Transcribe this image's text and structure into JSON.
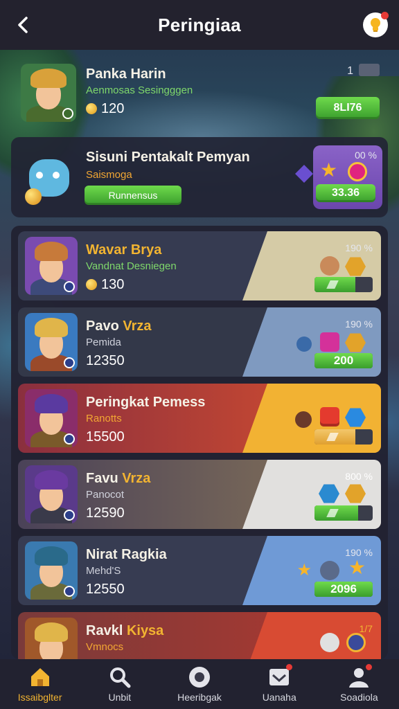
{
  "header": {
    "title": "Peringiaa"
  },
  "featured": {
    "name": "Panka Harin",
    "subtitle": "Aenmosas Sesingggen",
    "score": "120",
    "rank": "1",
    "button": "8LI76"
  },
  "second": {
    "name": "Sisuni Pentakalt Pemyan",
    "subtitle": "Saismoga",
    "button": "Runnensus",
    "rank": "00 %",
    "points": "33.36"
  },
  "rows": [
    {
      "name": "Wavar",
      "name_hl": "Brya",
      "subtitle": "Vandnat Desniegen",
      "score": "130",
      "rank": "190 %",
      "progress": 0.7,
      "prog_label": "",
      "bg": "#363b51",
      "panel": "#d5cba6"
    },
    {
      "name": "Pavo",
      "name_hl": "Vrza",
      "subtitle": "Pemida",
      "score": "12350",
      "rank": "190 %",
      "progress": 1,
      "prog_label": "200",
      "bg": "#333849",
      "panel": "#7f9ac0"
    },
    {
      "name": "Peringkat Pemess",
      "name_hl": "",
      "subtitle": "Ranotts",
      "score": "15500",
      "rank": "",
      "progress": 0.7,
      "prog_label": "",
      "bg": "#d9502e",
      "panel": "#f2b233"
    },
    {
      "name": "Favu",
      "name_hl": "Vrza",
      "subtitle": "Panocot",
      "score": "12590",
      "rank": "800 %",
      "progress": 0.75,
      "prog_label": "",
      "bg": "#7a6b57",
      "panel": "#e1e0de"
    },
    {
      "name": "Nirat Ragkia",
      "name_hl": "",
      "subtitle": "Mehd'S",
      "score": "12550",
      "rank": "190 %",
      "progress": 1,
      "prog_label": "2096",
      "bg": "#373c52",
      "panel": "#6f9ad6"
    },
    {
      "name": "Ravkl",
      "name_hl": "Kiysa",
      "subtitle": "Vmnocs",
      "score": "",
      "rank": "1/7",
      "progress": 0,
      "prog_label": "",
      "bg": "#b2382f",
      "panel": "#d84b33"
    }
  ],
  "nav": [
    {
      "label": "Issaibglter",
      "icon": "home-icon",
      "active": true
    },
    {
      "label": "Unbit",
      "icon": "search-icon",
      "active": false
    },
    {
      "label": "Heeribgak",
      "icon": "compass-icon",
      "active": false
    },
    {
      "label": "Uanaha",
      "icon": "inbox-icon",
      "active": false
    },
    {
      "label": "Soadiola",
      "icon": "profile-icon",
      "active": false
    }
  ],
  "colors": {
    "accent": "#f2b431",
    "green": "#4fc03a",
    "purple": "#7a55ba",
    "header": "#23222e"
  }
}
